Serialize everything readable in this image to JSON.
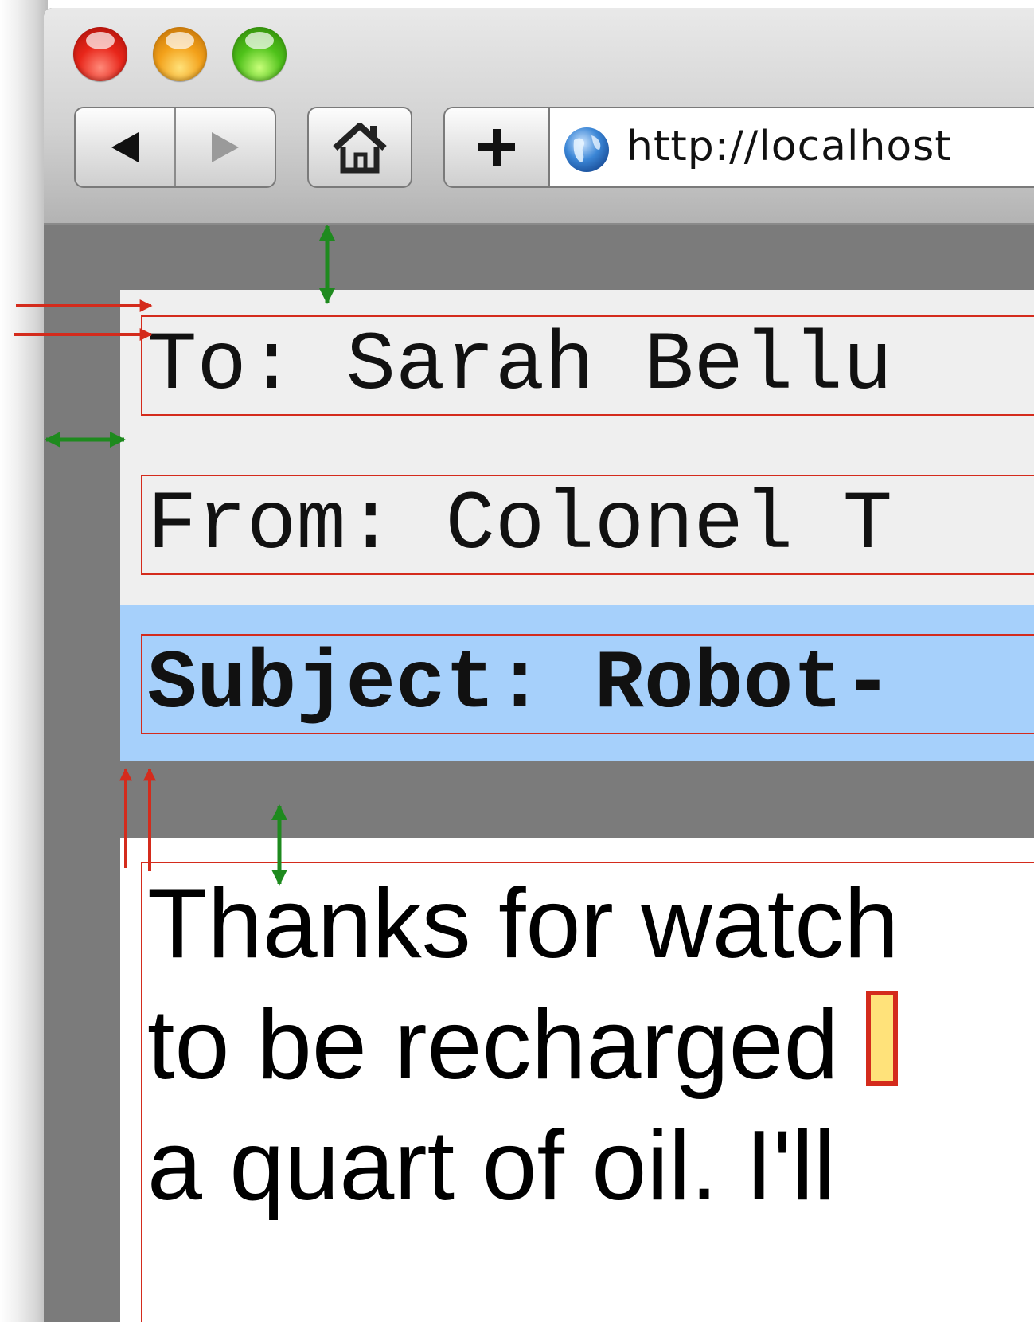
{
  "browser": {
    "url": "http://localhost",
    "nav": {
      "back_icon": "back-arrow-icon",
      "forward_icon": "forward-arrow-icon"
    },
    "home_icon": "home-icon",
    "add_icon": "plus-icon",
    "site_icon": "globe-icon"
  },
  "email": {
    "to": "To: Sarah Bellu",
    "from": "From: Colonel T",
    "subject": "Subject: Robot-",
    "body_lines": [
      "Thanks for watch",
      "to be recharged ",
      "a quart of oil. I'll"
    ]
  },
  "colors": {
    "annotation_red": "#d42b1c",
    "annotation_green": "#1e8a1e",
    "subject_highlight": "#a6d0fb",
    "header_bg": "#efefef",
    "page_margin": "#7b7b7b"
  }
}
